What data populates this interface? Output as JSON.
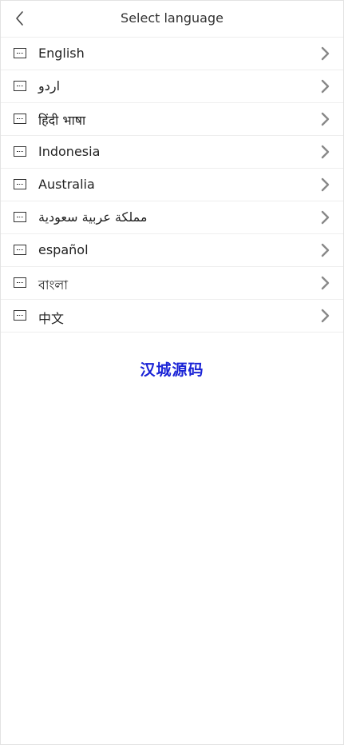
{
  "header": {
    "title": "Select language",
    "back_icon": "chevron-left-icon"
  },
  "languages": [
    {
      "label": "English",
      "icon": "flag-icon"
    },
    {
      "label": "اردو",
      "icon": "flag-icon"
    },
    {
      "label": "हिंदी भाषा",
      "icon": "flag-icon"
    },
    {
      "label": "Indonesia",
      "icon": "flag-icon"
    },
    {
      "label": "Australia",
      "icon": "flag-icon"
    },
    {
      "label": "مملكة عربية سعودية",
      "icon": "flag-icon"
    },
    {
      "label": "español",
      "icon": "flag-icon"
    },
    {
      "label": "বাংলা",
      "icon": "flag-icon"
    },
    {
      "label": "中文",
      "icon": "flag-icon"
    }
  ],
  "watermark": "汉城源码",
  "colors": {
    "watermark": "#1a23d6",
    "chevron": "#888888",
    "divider": "#eeeeee"
  }
}
